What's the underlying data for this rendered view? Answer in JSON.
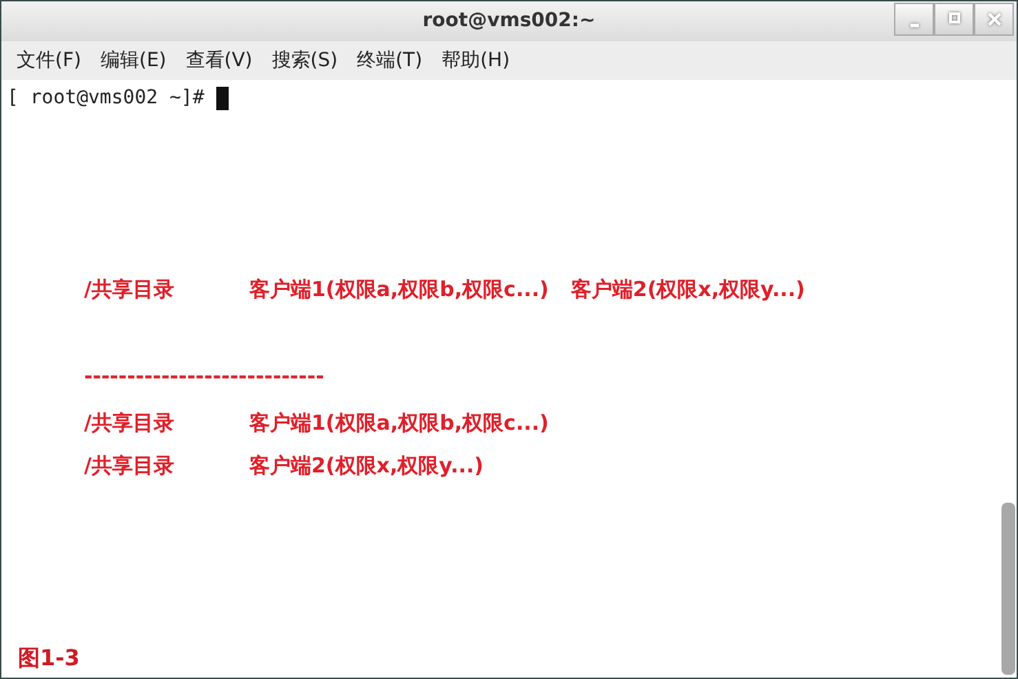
{
  "window": {
    "title": "root@vms002:~"
  },
  "menu": [
    "文件(F)",
    "编辑(E)",
    "查看(V)",
    "搜索(S)",
    "终端(T)",
    "帮助(H)"
  ],
  "terminal": {
    "prompt": "[ root@vms002 ~]# "
  },
  "annotation": {
    "lines": [
      {
        "kind": "row",
        "cells": [
          "/共享目录",
          "客户端1(权限a,权限b,权限c...)",
          "客户端2(权限x,权限y...)"
        ]
      },
      {
        "kind": "separator",
        "text": "----------------------------"
      },
      {
        "kind": "row",
        "cells": [
          "/共享目录",
          "客户端1(权限a,权限b,权限c...)"
        ]
      },
      {
        "kind": "row",
        "cells": [
          "/共享目录",
          "客户端2(权限x,权限y...)"
        ]
      }
    ],
    "figure_label": "图1-3"
  }
}
